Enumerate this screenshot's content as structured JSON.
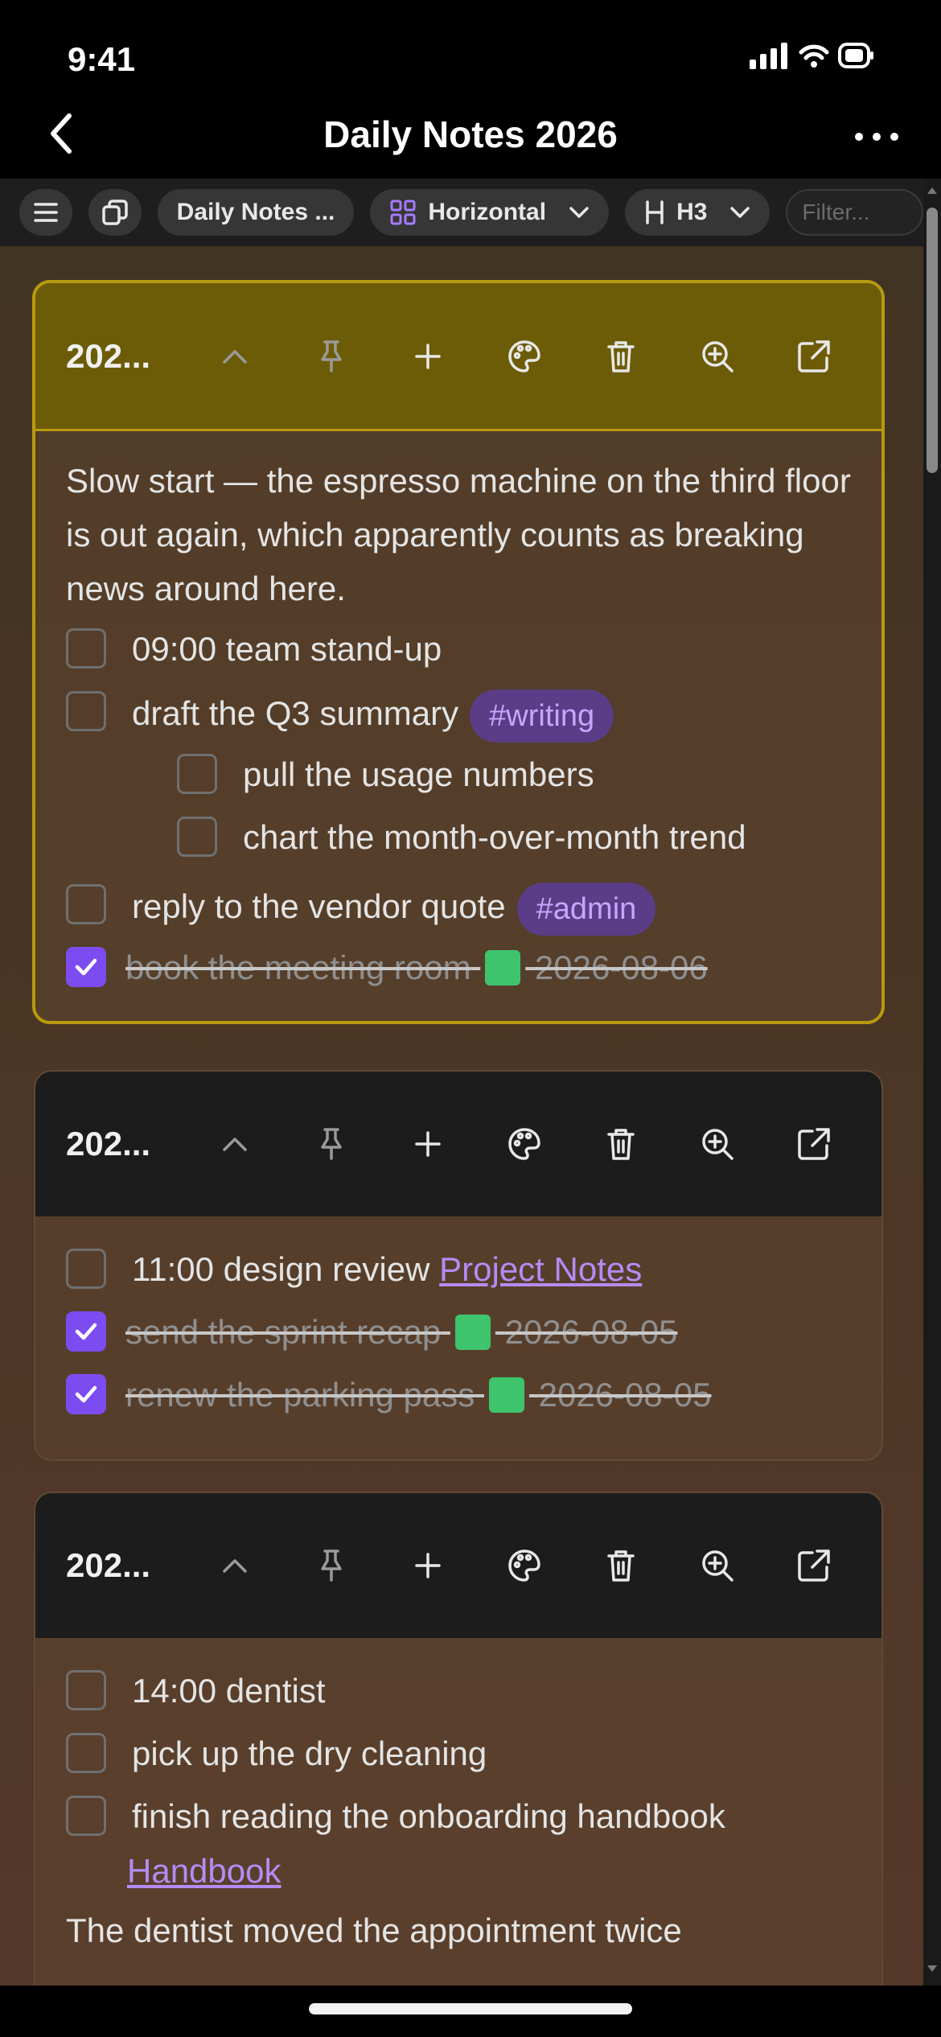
{
  "status_bar": {
    "time": "9:41"
  },
  "nav": {
    "title": "Daily Notes 2026"
  },
  "toolbar": {
    "folder_label": "Daily Notes ...",
    "layout_label": "Horizontal",
    "heading_label": "H3",
    "filter_placeholder": "Filter..."
  },
  "cards": [
    {
      "title": "202...",
      "intro": "Slow start — the espresso machine on the third floor is out again, which apparently counts as breaking news around here.",
      "tasks": [
        {
          "text": "09:00 team stand-up"
        },
        {
          "text": "draft the Q3 summary",
          "tag": "#writing"
        },
        {
          "text": "pull the usage numbers"
        },
        {
          "text": "chart the month-over-month trend"
        },
        {
          "text": "reply to the vendor quote",
          "tag": "#admin"
        },
        {
          "text": "book the meeting room",
          "date": "2026-08-06"
        }
      ]
    },
    {
      "title": "202...",
      "tasks": [
        {
          "text": "11:00 design review",
          "link": "Project Notes"
        },
        {
          "text": "send the sprint recap",
          "date": "2026-08-05"
        },
        {
          "text": "renew the parking pass",
          "date": "2026-08-05"
        }
      ]
    },
    {
      "title": "202...",
      "tasks": [
        {
          "text": "14:00 dentist"
        },
        {
          "text": "pick up the dry cleaning"
        },
        {
          "text": "finish reading the onboarding handbook",
          "link": "Handbook"
        }
      ],
      "outro": "The dentist moved the appointment twice"
    }
  ],
  "colors": {
    "accent": "#7d4cf0",
    "active_header": "#6d5c07",
    "active_border": "#b89a0e",
    "tag_bg": "#5a3d86",
    "tag_text": "#c9a4ff"
  }
}
